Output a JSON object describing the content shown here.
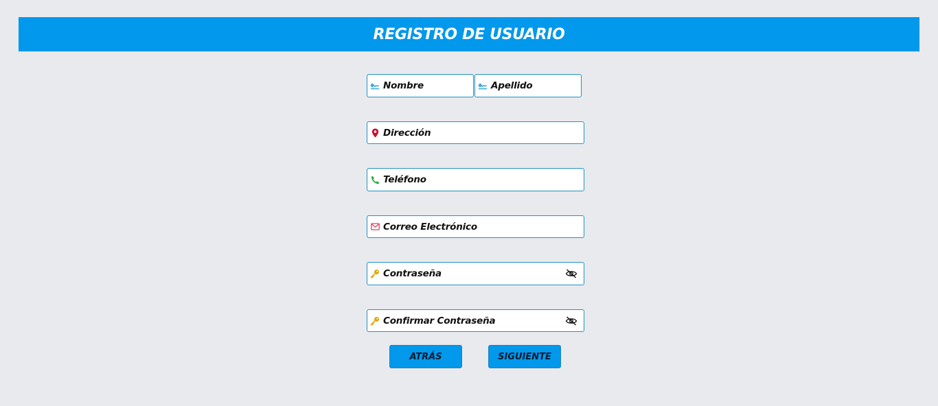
{
  "header": {
    "title": "REGISTRO DE USUARIO"
  },
  "form": {
    "nombre": {
      "placeholder": "Nombre",
      "icon": "signature-icon"
    },
    "apellido": {
      "placeholder": "Apellido",
      "icon": "signature-icon"
    },
    "direccion": {
      "placeholder": "Dirección",
      "icon": "map-pin-icon"
    },
    "telefono": {
      "placeholder": "Teléfono",
      "icon": "phone-icon"
    },
    "correo": {
      "placeholder": "Correo Electrónico",
      "icon": "envelope-icon"
    },
    "contrasena": {
      "placeholder": "Contraseña",
      "icon": "key-icon"
    },
    "confirmar": {
      "placeholder": "Confirmar Contraseña",
      "icon": "key-icon"
    }
  },
  "buttons": {
    "back": "ATRÁS",
    "next": "SIGUIENTE"
  },
  "colors": {
    "header_bg": "#0298ec",
    "page_bg": "#e9eaee",
    "field_border": "#1f94bf",
    "pin": "#c8102e",
    "phone": "#2eaa3f",
    "envelope": "#d9485f",
    "key": "#e0a800"
  }
}
